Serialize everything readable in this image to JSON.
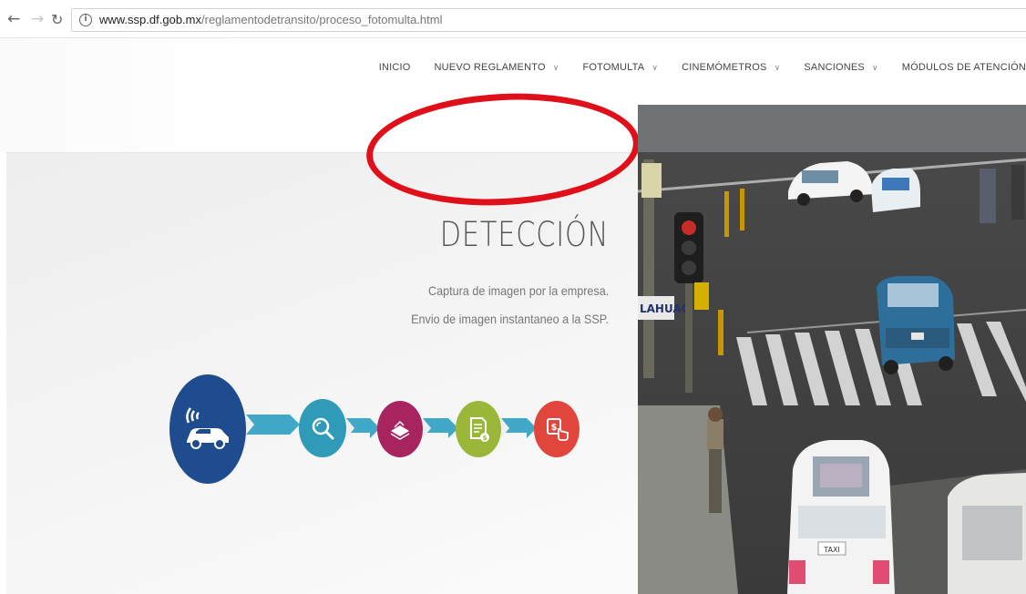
{
  "browser": {
    "url_host": "www.ssp.df.gob.mx",
    "url_path": "/reglamentodetransito/proceso_fotomulta.html"
  },
  "nav": {
    "items": [
      {
        "label": "INICIO",
        "has_dropdown": false
      },
      {
        "label": "NUEVO REGLAMENTO",
        "has_dropdown": true
      },
      {
        "label": "FOTOMULTA",
        "has_dropdown": true
      },
      {
        "label": "CINEMÓMETROS",
        "has_dropdown": true
      },
      {
        "label": "SANCIONES",
        "has_dropdown": true
      },
      {
        "label": "MÓDULOS DE ATENCIÓN",
        "has_dropdown": false
      }
    ]
  },
  "hero": {
    "title": "DETECCIÓN",
    "line1": "Captura de imagen por la empresa.",
    "line2": "Envio de imagen instantaneo a la SSP."
  },
  "steps": [
    {
      "icon": "car-radar-icon",
      "color": "#1f4b8f"
    },
    {
      "icon": "magnifier-icon",
      "color": "#2f9bb8"
    },
    {
      "icon": "documents-icon",
      "color": "#a8245e"
    },
    {
      "icon": "invoice-icon",
      "color": "#9ab73a"
    },
    {
      "icon": "payment-click-icon",
      "color": "#e0463c"
    }
  ],
  "photo": {
    "street_sign": "LAHUAC",
    "taxi_sign": "TAXI"
  },
  "colors": {
    "annotation": "#e0101a",
    "arrow": "#41a8c8"
  }
}
